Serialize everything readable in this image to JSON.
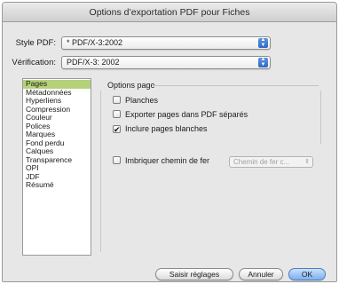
{
  "window": {
    "title": "Options d’exportation PDF pour Fiches"
  },
  "style_pdf": {
    "label": "Style PDF:",
    "value": "* PDF/X-3:2002"
  },
  "verification": {
    "label": "Vérification:",
    "value": "PDF/X-3: 2002"
  },
  "sidebar": {
    "items": [
      {
        "label": "Pages",
        "selected": true
      },
      {
        "label": "Métadonnées"
      },
      {
        "label": "Hyperliens"
      },
      {
        "label": "Compression"
      },
      {
        "label": "Couleur"
      },
      {
        "label": "Polices"
      },
      {
        "label": "Marques"
      },
      {
        "label": "Fond perdu"
      },
      {
        "label": "Calques"
      },
      {
        "label": "Transparence"
      },
      {
        "label": "OPI"
      },
      {
        "label": "JDF"
      },
      {
        "label": "Résumé"
      }
    ]
  },
  "options_page": {
    "title": "Options page",
    "planches": {
      "label": "Planches",
      "checked": false
    },
    "exporter": {
      "label": "Exporter pages dans PDF séparés",
      "checked": false
    },
    "inclure": {
      "label": "Inclure pages blanches",
      "checked": true
    },
    "imbriquer": {
      "label": "Imbriquer chemin de fer",
      "checked": false
    },
    "chemin_select": "Chemin de fer c..."
  },
  "buttons": {
    "saisir": "Saisir réglages",
    "annuler": "Annuler",
    "ok": "OK"
  }
}
